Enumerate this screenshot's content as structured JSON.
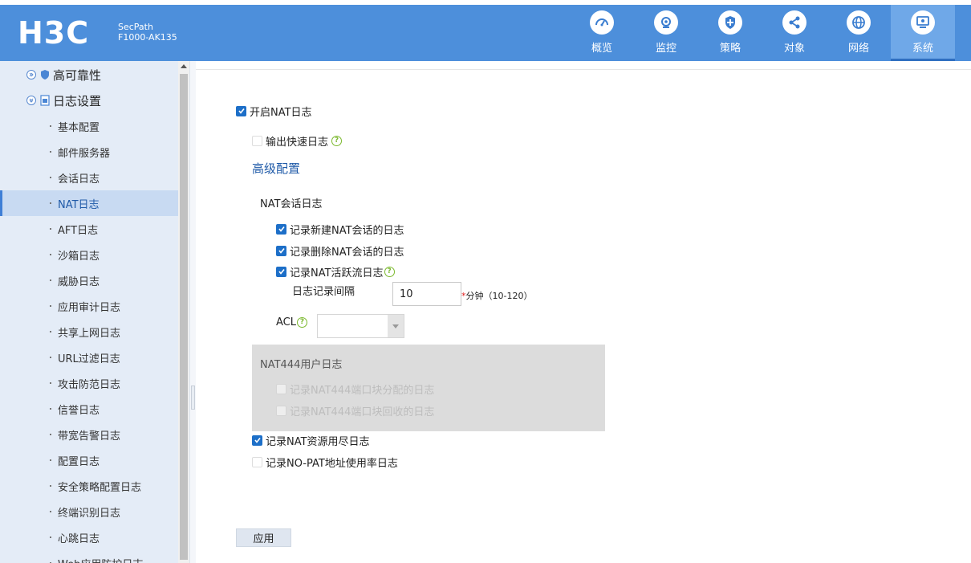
{
  "header": {
    "logo_text": "H3C",
    "product_line1": "SecPath",
    "product_line2": "F1000-AK135",
    "nav": [
      {
        "label": "概览",
        "icon": "dashboard-icon"
      },
      {
        "label": "监控",
        "icon": "monitor-icon"
      },
      {
        "label": "策略",
        "icon": "shield-icon"
      },
      {
        "label": "对象",
        "icon": "share-icon"
      },
      {
        "label": "网络",
        "icon": "globe-icon"
      },
      {
        "label": "系统",
        "icon": "system-icon",
        "active": true
      }
    ],
    "accent_color": "#4d8fdb"
  },
  "sidebar": {
    "parents": [
      {
        "label": "高可靠性"
      },
      {
        "label": "日志设置"
      }
    ],
    "children": [
      {
        "label": "基本配置"
      },
      {
        "label": "邮件服务器"
      },
      {
        "label": "会话日志"
      },
      {
        "label": "NAT日志",
        "active": true
      },
      {
        "label": "AFT日志"
      },
      {
        "label": "沙箱日志"
      },
      {
        "label": "威胁日志"
      },
      {
        "label": "应用审计日志"
      },
      {
        "label": "共享上网日志"
      },
      {
        "label": "URL过滤日志"
      },
      {
        "label": "攻击防范日志"
      },
      {
        "label": "信誉日志"
      },
      {
        "label": "带宽告警日志"
      },
      {
        "label": "配置日志"
      },
      {
        "label": "安全策略配置日志"
      },
      {
        "label": "终端识别日志"
      },
      {
        "label": "心跳日志"
      },
      {
        "label": "Web应用防护日志"
      }
    ]
  },
  "form": {
    "enable_nat_log": {
      "label": "开启NAT日志",
      "checked": true
    },
    "fast_log": {
      "label": "输出快速日志",
      "checked": false
    },
    "advanced_link": "高级配置",
    "nat_session_title": "NAT会话日志",
    "log_new_session": {
      "label": "记录新建NAT会话的日志",
      "checked": true
    },
    "log_delete_session": {
      "label": "记录删除NAT会话的日志",
      "checked": true
    },
    "log_active_flow": {
      "label": "记录NAT活跃流日志",
      "checked": true
    },
    "interval_label": "日志记录间隔",
    "interval_value": "10",
    "interval_required": "*",
    "interval_unit": "分钟（10-120）",
    "acl_label": "ACL",
    "acl_value": "",
    "nat444_title": "NAT444用户日志",
    "nat444_alloc": {
      "label": "记录NAT444端口块分配的日志",
      "checked": false,
      "disabled": true
    },
    "nat444_recycle": {
      "label": "记录NAT444端口块回收的日志",
      "checked": false,
      "disabled": true
    },
    "resource_exhausted": {
      "label": "记录NAT资源用尽日志",
      "checked": true
    },
    "nopat_usage": {
      "label": "记录NO-PAT地址使用率日志",
      "checked": false
    },
    "help_symbol": "?",
    "apply_label": "应用"
  }
}
